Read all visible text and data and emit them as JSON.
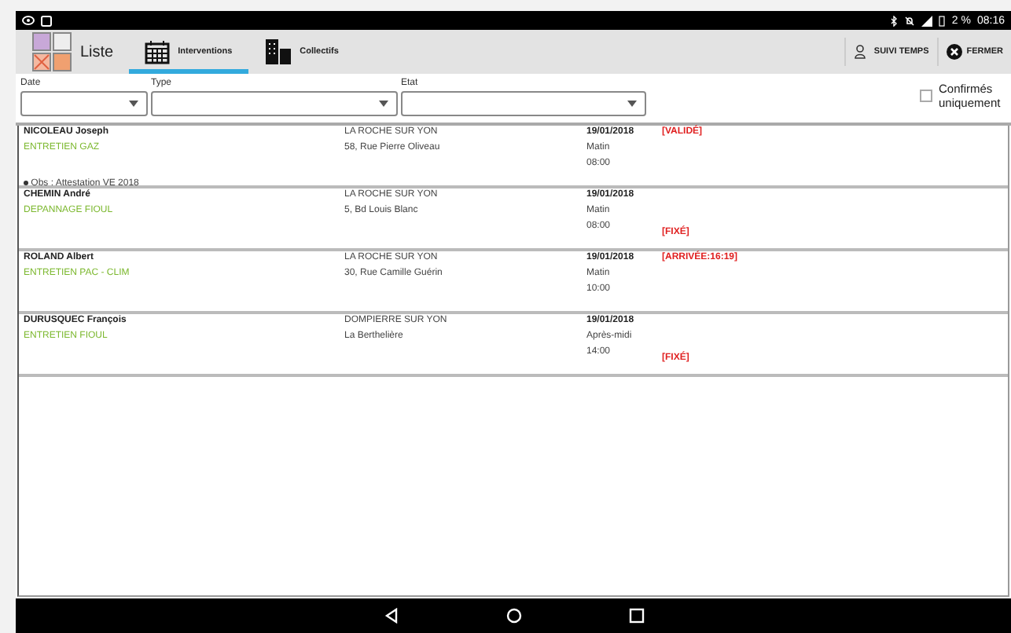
{
  "status_bar": {
    "battery": "2 %",
    "time": "08:16"
  },
  "tabs": [
    {
      "label": "Liste",
      "selected": false,
      "kind": "list"
    },
    {
      "label": "Interventions",
      "selected": true,
      "kind": "calendar"
    },
    {
      "label": "Collectifs",
      "selected": false,
      "kind": "building"
    }
  ],
  "actions": [
    {
      "label": "SUIVI TEMPS",
      "kind": "person"
    },
    {
      "label": "FERMER",
      "kind": "close"
    }
  ],
  "filters": [
    {
      "label": "Date"
    },
    {
      "label": "Type"
    },
    {
      "label": "Etat"
    }
  ],
  "confirmed_only": {
    "label": "Confirmés uniquement",
    "checked": false
  },
  "rows": [
    {
      "name": "NICOLEAU Joseph",
      "type": "ENTRETIEN GAZ",
      "city": "LA ROCHE SUR YON",
      "address": "58, Rue Pierre Oliveau",
      "date": "19/01/2018",
      "period": "Matin",
      "time": "08:00",
      "status": "[VALIDÉ]",
      "kind": "validated",
      "obs": "Obs : Attestation VE 2018"
    },
    {
      "name": "CHEMIN André",
      "type": "DEPANNAGE FIOUL",
      "city": "LA ROCHE SUR YON",
      "address": "5, Bd Louis Blanc",
      "date": "19/01/2018",
      "period": "Matin",
      "time": "08:00",
      "status": "[FIXÉ]",
      "kind": "fixed"
    },
    {
      "name": "ROLAND Albert",
      "type": "ENTRETIEN PAC - CLIM",
      "city": "LA ROCHE SUR YON",
      "address": "30, Rue Camille Guérin",
      "date": "19/01/2018",
      "period": "Matin",
      "time": "10:00",
      "status": "[ARRIVÉE:16:19]",
      "kind": "arrived"
    },
    {
      "name": "DURUSQUEC François",
      "type": "ENTRETIEN FIOUL",
      "city": "DOMPIERRE SUR YON",
      "address": "La Berthelière",
      "date": "19/01/2018",
      "period": "Après-midi",
      "time": "14:00",
      "status": "[FIXÉ]",
      "kind": "fixed"
    }
  ]
}
